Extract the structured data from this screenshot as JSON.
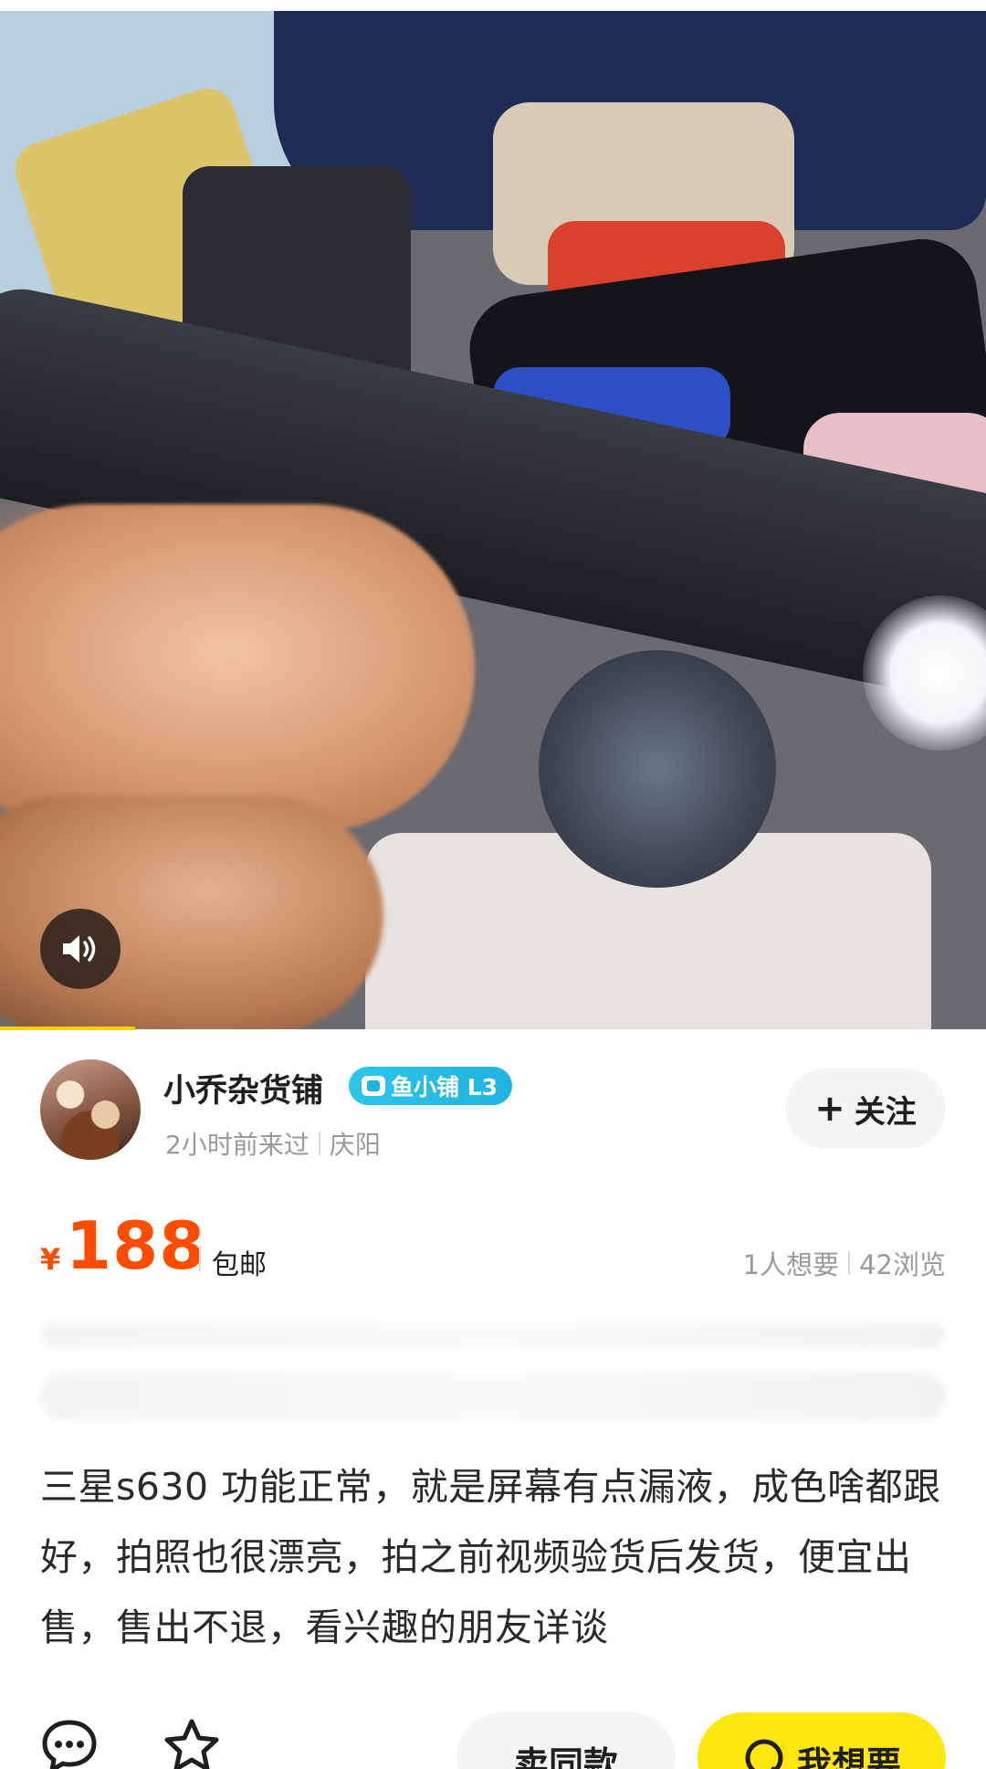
{
  "video": {
    "mute_icon": "speaker-icon",
    "progress_fraction": 0.137
  },
  "seller": {
    "name": "小乔杂货铺",
    "badge": "鱼小铺 L3",
    "last_seen": "2小时前来过",
    "location": "庆阳",
    "follow_label": "关注"
  },
  "listing": {
    "currency": "¥",
    "price": "188",
    "shipping": "包邮",
    "wants": "1人想要",
    "views": "42浏览",
    "description": "三星s630 功能正常，就是屏幕有点漏液，成色啥都跟好，拍照也很漂亮，拍之前视频验货后发货，便宜出售，售出不退，看兴趣的朋友详谈"
  },
  "actions": {
    "comment_icon": "comment-icon",
    "favorite_icon": "star-icon",
    "sell_same_label": "卖同款",
    "want_label": "我想要"
  },
  "colors": {
    "price": "#ff4d00",
    "accent": "#ffe60f",
    "badge": "#20b3e0"
  }
}
